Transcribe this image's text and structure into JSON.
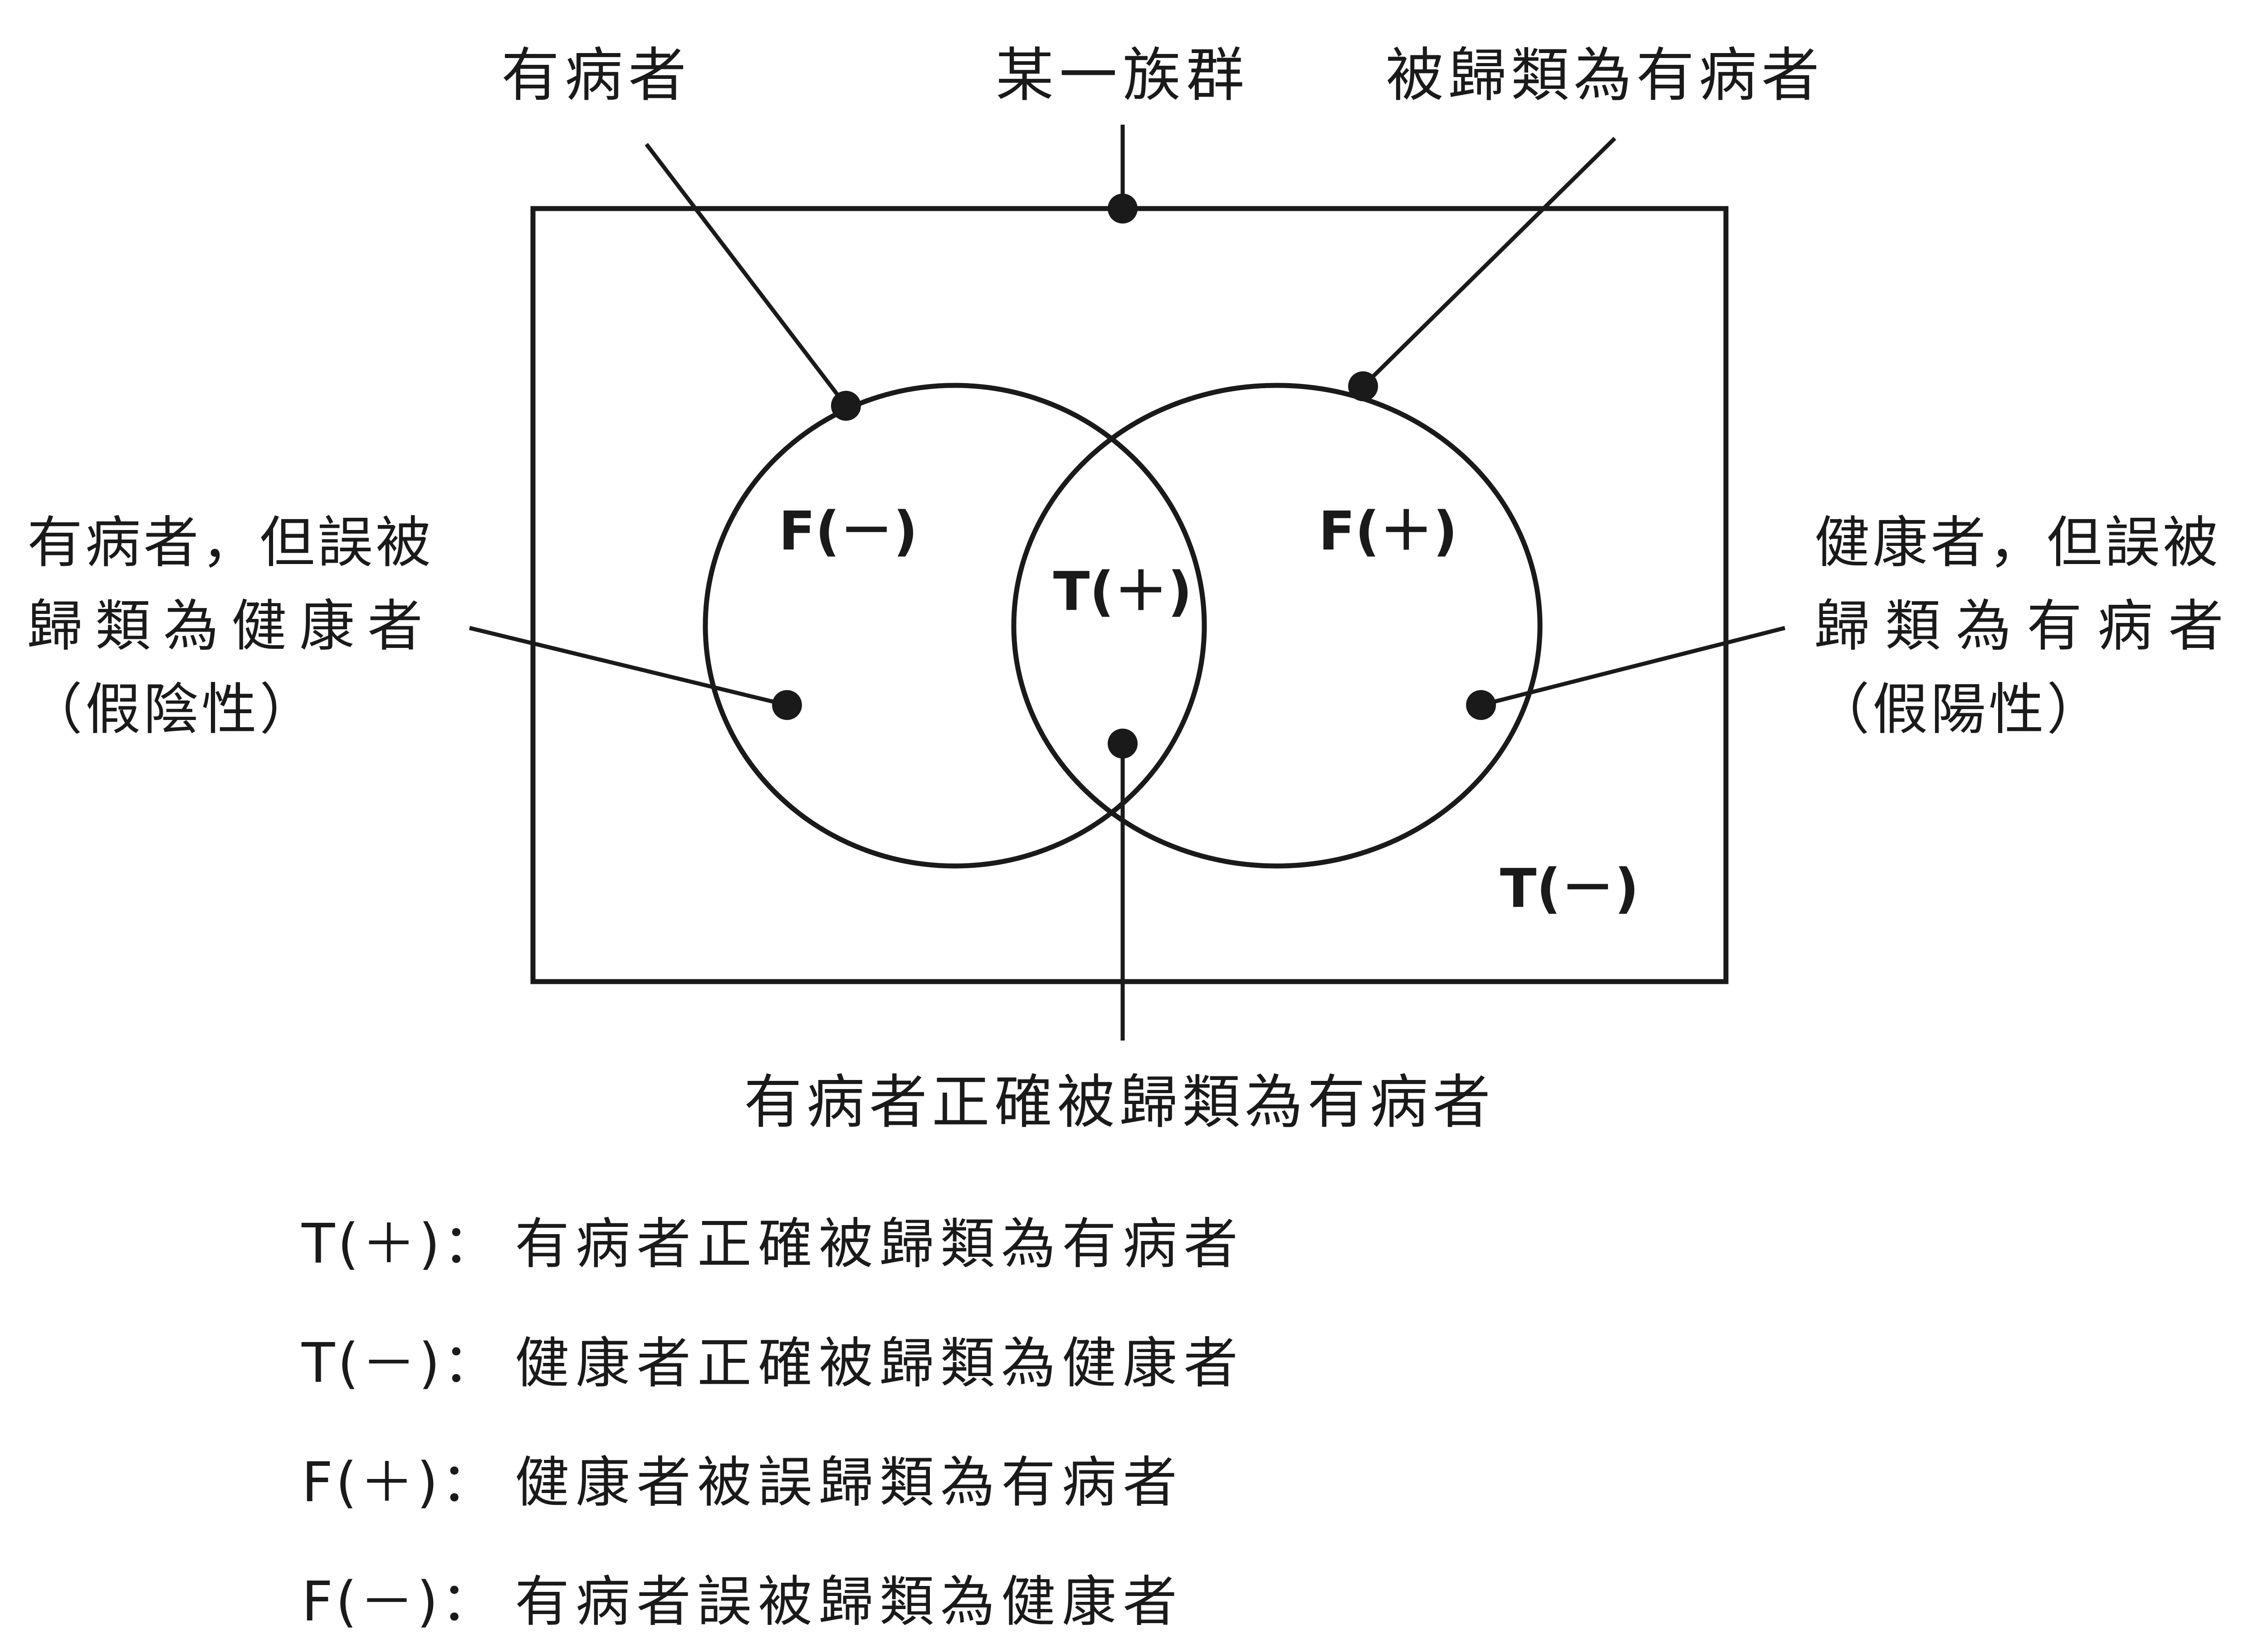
{
  "labels": {
    "diseased": "有病者",
    "population": "某一族群",
    "classified_diseased": "被歸類為有病者",
    "false_negative_note": [
      "有病者，但誤被",
      "歸類為健康者",
      "（假陰性）"
    ],
    "false_positive_note": [
      "健康者，但誤被",
      "歸類為有病者",
      "（假陽性）"
    ],
    "true_positive_note": "有病者正確被歸類為有病者"
  },
  "regions": {
    "false_negative": "F(－)",
    "true_positive": "T(＋)",
    "false_positive": "F(＋)",
    "true_negative": "T(－)"
  },
  "legend": [
    {
      "code": "T(＋)：",
      "text": "有病者正確被歸類為有病者"
    },
    {
      "code": "T(－)：",
      "text": "健康者正確被歸類為健康者"
    },
    {
      "code": "F(＋)：",
      "text": "健康者被誤歸類為有病者"
    },
    {
      "code": "F(－)：",
      "text": "有病者誤被歸類為健康者"
    }
  ],
  "colors": {
    "ink": "#1a1a1a",
    "background": "#ffffff"
  }
}
